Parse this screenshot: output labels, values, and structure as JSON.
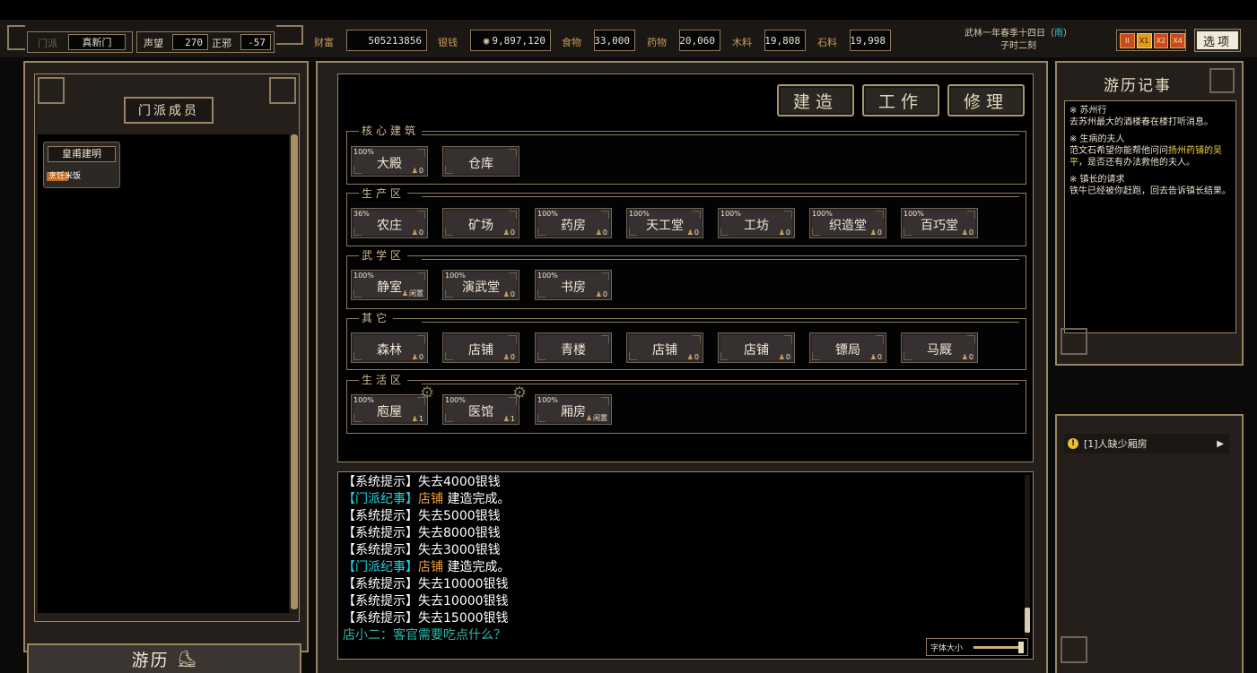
{
  "sect": {
    "label": "门派",
    "value": "真新门"
  },
  "reputation": {
    "label": "声望",
    "value": "270"
  },
  "morality": {
    "label": "正邪",
    "value": "-57"
  },
  "resources": [
    {
      "label": "财富",
      "value": "505213856"
    },
    {
      "label": "银钱",
      "value": "9,897,120"
    },
    {
      "label": "食物",
      "value": "33,000"
    },
    {
      "label": "药物",
      "value": "20,060"
    },
    {
      "label": "木料",
      "value": "19,808"
    },
    {
      "label": "石料",
      "value": "19,998"
    }
  ],
  "date": {
    "line1": "武林一年春季十四日",
    "weather": "雨",
    "line2": "子时二刻"
  },
  "speed_buttons": [
    "II",
    "X1",
    "X2",
    "X4"
  ],
  "options_label": "选项",
  "members": {
    "title": "门派成员",
    "list": [
      {
        "name": "皇甫建明",
        "tag": "烹饪米饭"
      }
    ]
  },
  "travel_label": "游历",
  "actions": {
    "build": "建造",
    "work": "工作",
    "repair": "修理"
  },
  "sections": [
    {
      "title": "核心建筑",
      "buildings": [
        {
          "pct": "100%",
          "name": "大殿",
          "count": "0"
        },
        {
          "pct": "",
          "name": "仓库",
          "count": ""
        }
      ]
    },
    {
      "title": "生产区",
      "buildings": [
        {
          "pct": "36%",
          "name": "农庄",
          "count": "0"
        },
        {
          "pct": "",
          "name": "矿场",
          "count": "0"
        },
        {
          "pct": "100%",
          "name": "药房",
          "count": "0"
        },
        {
          "pct": "100%",
          "name": "天工堂",
          "count": "0"
        },
        {
          "pct": "100%",
          "name": "工坊",
          "count": "0"
        },
        {
          "pct": "100%",
          "name": "织造堂",
          "count": "0"
        },
        {
          "pct": "100%",
          "name": "百巧堂",
          "count": "0"
        }
      ]
    },
    {
      "title": "武学区",
      "buildings": [
        {
          "pct": "100%",
          "name": "静室",
          "count": "闲置"
        },
        {
          "pct": "100%",
          "name": "演武堂",
          "count": "0"
        },
        {
          "pct": "100%",
          "name": "书房",
          "count": "0"
        }
      ]
    },
    {
      "title": "其它",
      "buildings": [
        {
          "pct": "",
          "name": "森林",
          "count": "0"
        },
        {
          "pct": "",
          "name": "店铺",
          "count": "0"
        },
        {
          "pct": "",
          "name": "青楼",
          "count": ""
        },
        {
          "pct": "",
          "name": "店铺",
          "count": "0"
        },
        {
          "pct": "",
          "name": "店铺",
          "count": "0"
        },
        {
          "pct": "",
          "name": "镖局",
          "count": "0"
        },
        {
          "pct": "",
          "name": "马厩",
          "count": "0"
        }
      ]
    },
    {
      "title": "生活区",
      "buildings": [
        {
          "pct": "100%",
          "name": "庖屋",
          "count": "1"
        },
        {
          "pct": "100%",
          "name": "医馆",
          "count": "1"
        },
        {
          "pct": "100%",
          "name": "厢房",
          "count": "闲置"
        }
      ]
    }
  ],
  "log": [
    [
      {
        "t": "【系统提示】",
        "c": "wh"
      },
      {
        "t": "失去4000银钱",
        "c": "wh"
      }
    ],
    [
      {
        "t": "【门派纪事】",
        "c": "cy"
      },
      {
        "t": "店铺",
        "c": "or"
      },
      {
        "t": " 建造完成。",
        "c": "wh"
      }
    ],
    [
      {
        "t": "【系统提示】",
        "c": "wh"
      },
      {
        "t": "失去5000银钱",
        "c": "wh"
      }
    ],
    [
      {
        "t": "【系统提示】",
        "c": "wh"
      },
      {
        "t": "失去8000银钱",
        "c": "wh"
      }
    ],
    [
      {
        "t": "【系统提示】",
        "c": "wh"
      },
      {
        "t": "失去3000银钱",
        "c": "wh"
      }
    ],
    [
      {
        "t": "【门派纪事】",
        "c": "cy"
      },
      {
        "t": "店铺",
        "c": "or"
      },
      {
        "t": " 建造完成。",
        "c": "wh"
      }
    ],
    [
      {
        "t": "【系统提示】",
        "c": "wh"
      },
      {
        "t": "失去10000银钱",
        "c": "wh"
      }
    ],
    [
      {
        "t": "【系统提示】",
        "c": "wh"
      },
      {
        "t": "失去10000银钱",
        "c": "wh"
      }
    ],
    [
      {
        "t": "【系统提示】",
        "c": "wh"
      },
      {
        "t": "失去15000银钱",
        "c": "wh"
      }
    ],
    [
      {
        "t": "店小二：客官需要吃点什么？",
        "c": "tl"
      }
    ]
  ],
  "font_size_label": "字体大小",
  "journal": {
    "title": "游历记事",
    "entries": [
      {
        "title": "※ 苏州行",
        "parts": [
          {
            "t": "去苏州最大的酒楼春在楼打听消息。",
            "hl": false
          }
        ]
      },
      {
        "title": "※ 生病的夫人",
        "parts": [
          {
            "t": "范文石希望你能帮他问问",
            "hl": false
          },
          {
            "t": "扬州药铺的吴平",
            "hl": true
          },
          {
            "t": "，是否还有办法救他的夫人。",
            "hl": false
          }
        ]
      },
      {
        "title": "※ 镇长的请求",
        "parts": [
          {
            "t": "铁牛已经被你赶跑，回去告诉镇长结果。",
            "hl": false
          }
        ]
      }
    ]
  },
  "notification": {
    "text": "[1]人缺少厢房"
  },
  "colors": {
    "gold": "#c99a55",
    "panel": "#241f1b",
    "border": "#9a8663",
    "highlight": "#f0d040"
  }
}
